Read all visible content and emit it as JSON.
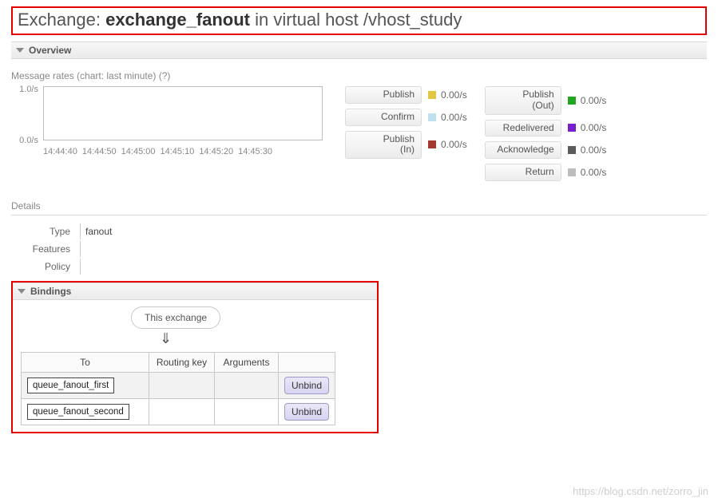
{
  "title": {
    "prefix": "Exchange: ",
    "name": "exchange_fanout",
    "suffix": " in virtual host /vhost_study"
  },
  "overview": {
    "heading": "Overview",
    "rates_heading": "Message rates (chart: last minute) (?)",
    "chart_data": {
      "type": "line",
      "ylim": [
        0.0,
        1.0
      ],
      "y_ticks": [
        "1.0/s",
        "0.0/s"
      ],
      "x_ticks": [
        "14:44:40",
        "14:44:50",
        "14:45:00",
        "14:45:10",
        "14:45:20",
        "14:45:30"
      ],
      "series": []
    },
    "rate_items_left": [
      {
        "label": "Publish",
        "color": "#e3c642",
        "value": "0.00/s"
      },
      {
        "label": "Confirm",
        "color": "#bfe1ef",
        "value": "0.00/s"
      },
      {
        "label": "Publish\n(In)",
        "color": "#a43a2f",
        "value": "0.00/s"
      }
    ],
    "rate_items_right": [
      {
        "label": "Publish\n(Out)",
        "color": "#1fa81f",
        "value": "0.00/s"
      },
      {
        "label": "Redelivered",
        "color": "#7a1fd0",
        "value": "0.00/s"
      },
      {
        "label": "Acknowledge",
        "color": "#5a5a5a",
        "value": "0.00/s"
      },
      {
        "label": "Return",
        "color": "#bdbdbd",
        "value": "0.00/s"
      }
    ]
  },
  "details": {
    "heading": "Details",
    "rows": {
      "type_label": "Type",
      "type_value": "fanout",
      "features_label": "Features",
      "features_value": "",
      "policy_label": "Policy",
      "policy_value": ""
    }
  },
  "bindings": {
    "heading": "Bindings",
    "this_exchange_label": "This exchange",
    "arrow": "⇓",
    "columns": {
      "to": "To",
      "routing_key": "Routing key",
      "arguments": "Arguments"
    },
    "rows": [
      {
        "to": "queue_fanout_first",
        "routing_key": "",
        "arguments": "",
        "action": "Unbind"
      },
      {
        "to": "queue_fanout_second",
        "routing_key": "",
        "arguments": "",
        "action": "Unbind"
      }
    ]
  },
  "watermark": "https://blog.csdn.net/zorro_jin"
}
